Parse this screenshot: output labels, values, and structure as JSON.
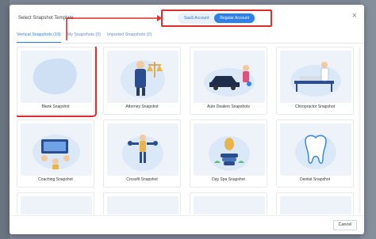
{
  "modal": {
    "title": "Select Snapshot Template",
    "close_glyph": "×"
  },
  "account_toggle": {
    "options": [
      "SaaS Account",
      "Regular Account"
    ],
    "selected": "Regular Account"
  },
  "tabs": [
    {
      "label": "Vertical Snapshots (19)",
      "active": true
    },
    {
      "label": "My Snapshots (0)",
      "active": false
    },
    {
      "label": "Imported Snapshots (0)",
      "active": false
    }
  ],
  "cards": [
    {
      "label": "Blank Snapshot",
      "icon": "blank-blob"
    },
    {
      "label": "Attorney Snapshot",
      "icon": "attorney-illustration"
    },
    {
      "label": "Auto Dealers Snapshots",
      "icon": "car-dealer-illustration"
    },
    {
      "label": "Chiropractor Snapshot",
      "icon": "chiropractor-illustration"
    },
    {
      "label": "Coaching Snapshot",
      "icon": "coaching-illustration"
    },
    {
      "label": "Crossfit Snapshot",
      "icon": "crossfit-illustration"
    },
    {
      "label": "Day Spa Snapshot",
      "icon": "day-spa-illustration"
    },
    {
      "label": "Dentist Snapshot",
      "icon": "tooth-illustration"
    }
  ],
  "footer": {
    "cancel_label": "Cancel"
  },
  "colors": {
    "accent": "#2e80e6",
    "annotation_red": "#e22b2b"
  }
}
